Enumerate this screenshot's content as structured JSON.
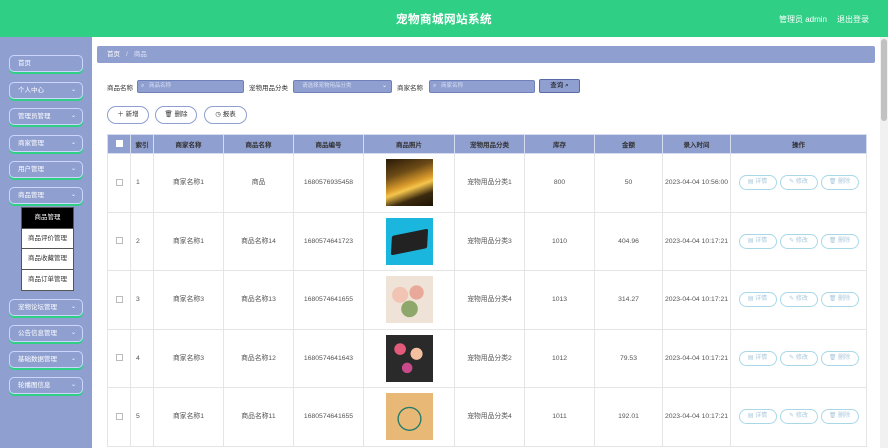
{
  "app": {
    "title": "宠物商城网站系统",
    "user": "管理员 admin",
    "logout": "退出登录"
  },
  "sidebar": {
    "items": [
      {
        "label": "首页",
        "has_chevron": false
      },
      {
        "label": "个人中心",
        "has_chevron": true
      },
      {
        "label": "管理员管理",
        "has_chevron": true
      },
      {
        "label": "商家管理",
        "has_chevron": true
      },
      {
        "label": "用户管理",
        "has_chevron": true
      },
      {
        "label": "商品管理",
        "has_chevron": true
      },
      {
        "label": "宠物论坛管理",
        "has_chevron": true
      },
      {
        "label": "公告信息管理",
        "has_chevron": true
      },
      {
        "label": "基础数据管理",
        "has_chevron": true
      },
      {
        "label": "轮播图信息",
        "has_chevron": true
      }
    ],
    "submenu": [
      "商品管理",
      "商品评价管理",
      "商品收藏管理",
      "商品订单管理"
    ],
    "submenu_active": 0
  },
  "breadcrumb": {
    "home": "首页",
    "sep": "/",
    "current": "商品"
  },
  "search": {
    "label1": "商品名称",
    "placeholder1": "商品名称",
    "label2": "宠物用品分类",
    "placeholder2": "请选择宠物用品分类",
    "label3": "商家名称",
    "placeholder3": "商家名称",
    "query": "查询"
  },
  "actions": {
    "add": "新增",
    "delete": "删除",
    "report": "报表"
  },
  "table": {
    "headers": [
      "",
      "索引",
      "商家名称",
      "商品名称",
      "商品编号",
      "商品照片",
      "宠物用品分类",
      "库存",
      "金额",
      "录入时间",
      "操作"
    ],
    "rows": [
      {
        "index": "1",
        "shop": "商家名称1",
        "name": "商品",
        "code": "1680576935458",
        "category": "宠物用品分类1",
        "stock": "800",
        "price": "50",
        "time": "2023-04-04 10:56:00",
        "photo": "road"
      },
      {
        "index": "2",
        "shop": "商家名称1",
        "name": "商品名称14",
        "code": "1680574641723",
        "category": "宠物用品分类3",
        "stock": "1010",
        "price": "404.96",
        "time": "2023-04-04 10:17:21",
        "photo": "laptop"
      },
      {
        "index": "3",
        "shop": "商家名称3",
        "name": "商品名称13",
        "code": "1680574641655",
        "category": "宠物用品分类4",
        "stock": "1013",
        "price": "314.27",
        "time": "2023-04-04 10:17:21",
        "photo": "flowers"
      },
      {
        "index": "4",
        "shop": "商家名称3",
        "name": "商品名称12",
        "code": "1680574641643",
        "category": "宠物用品分类2",
        "stock": "1012",
        "price": "79.53",
        "time": "2023-04-04 10:17:21",
        "photo": "cosmetics"
      },
      {
        "index": "5",
        "shop": "商家名称1",
        "name": "商品名称11",
        "code": "1680574641655",
        "category": "宠物用品分类4",
        "stock": "1011",
        "price": "192.01",
        "time": "2023-04-04 10:17:21",
        "photo": "necklace"
      }
    ],
    "op_labels": {
      "detail": "详情",
      "edit": "修改",
      "delete": "删除"
    }
  },
  "colors": {
    "topbar": "#2fcf86",
    "sidebar": "#8f9fd0",
    "accent_green": "#2fcf86"
  }
}
